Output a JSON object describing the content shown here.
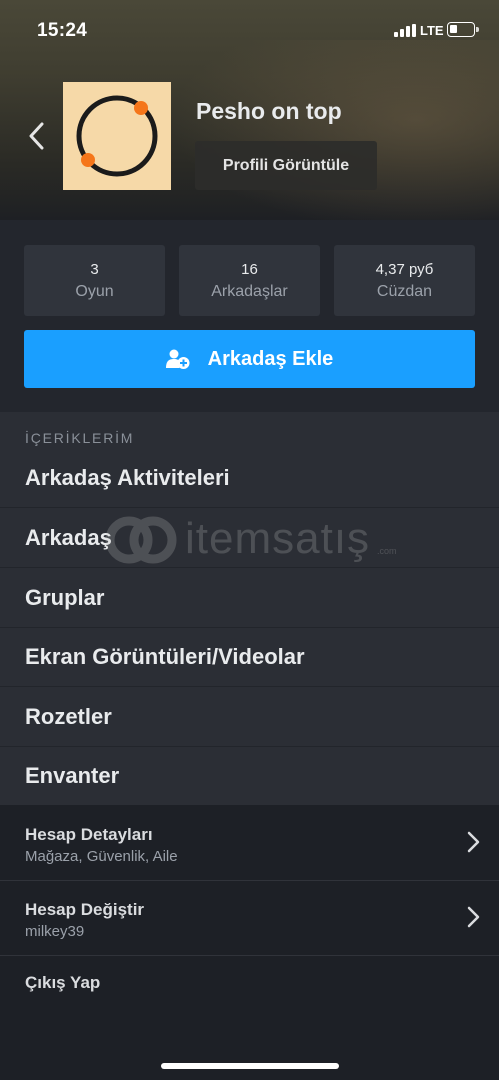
{
  "status_bar": {
    "time": "15:24",
    "network": "LTE",
    "battery_level": 0.25
  },
  "profile": {
    "name": "Pesho on top",
    "view_profile_label": "Profili Görüntüle",
    "avatar_colors": {
      "background": "#f6d9a8",
      "ring": "#1b1b1b",
      "dots": "#f5761a"
    }
  },
  "stats": [
    {
      "value": "3",
      "label": "Oyun"
    },
    {
      "value": "16",
      "label": "Arkadaşlar"
    },
    {
      "value": "4,37 руб",
      "label": "Cüzdan"
    }
  ],
  "add_friend": {
    "label": "Arkadaş Ekle",
    "icon": "add-user-icon",
    "color": "#1a9fff"
  },
  "contents": {
    "section_title": "İÇERİKLERİM",
    "items": [
      {
        "label": "Arkadaş Aktiviteleri"
      },
      {
        "label": "Arkadaş"
      },
      {
        "label": "Gruplar"
      },
      {
        "label": "Ekran Görüntüleri/Videolar"
      },
      {
        "label": "Rozetler"
      },
      {
        "label": "Envanter"
      }
    ]
  },
  "account": {
    "items": [
      {
        "title": "Hesap Detayları",
        "subtitle": "Mağaza, Güvenlik, Aile"
      },
      {
        "title": "Hesap Değiştir",
        "subtitle": "milkey39"
      }
    ],
    "logout_label": "Çıkış Yap"
  },
  "watermark": {
    "text": "itemsatış",
    "suffix": ".com"
  }
}
